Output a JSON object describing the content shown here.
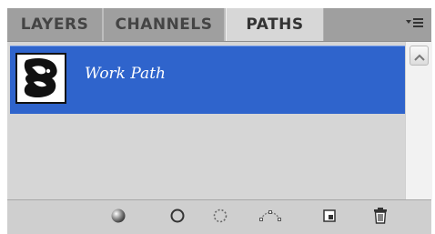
{
  "tabs": [
    {
      "label": "LAYERS"
    },
    {
      "label": "CHANNELS"
    },
    {
      "label": "PATHS",
      "active": true
    }
  ],
  "paths": [
    {
      "name": "Work Path",
      "selected": true
    }
  ],
  "icons": {
    "panel_menu": "panel-menu-icon",
    "fill_path": "fill-path-icon",
    "stroke_path": "stroke-path-icon",
    "load_selection": "load-path-as-selection-icon",
    "make_work_path": "make-work-path-icon",
    "new_path": "new-path-icon",
    "delete_path": "trash-icon"
  },
  "colors": {
    "selection": "#2f64cc",
    "panel_bg": "#d6d6d6",
    "tabbar_bg": "#9f9f9f"
  }
}
